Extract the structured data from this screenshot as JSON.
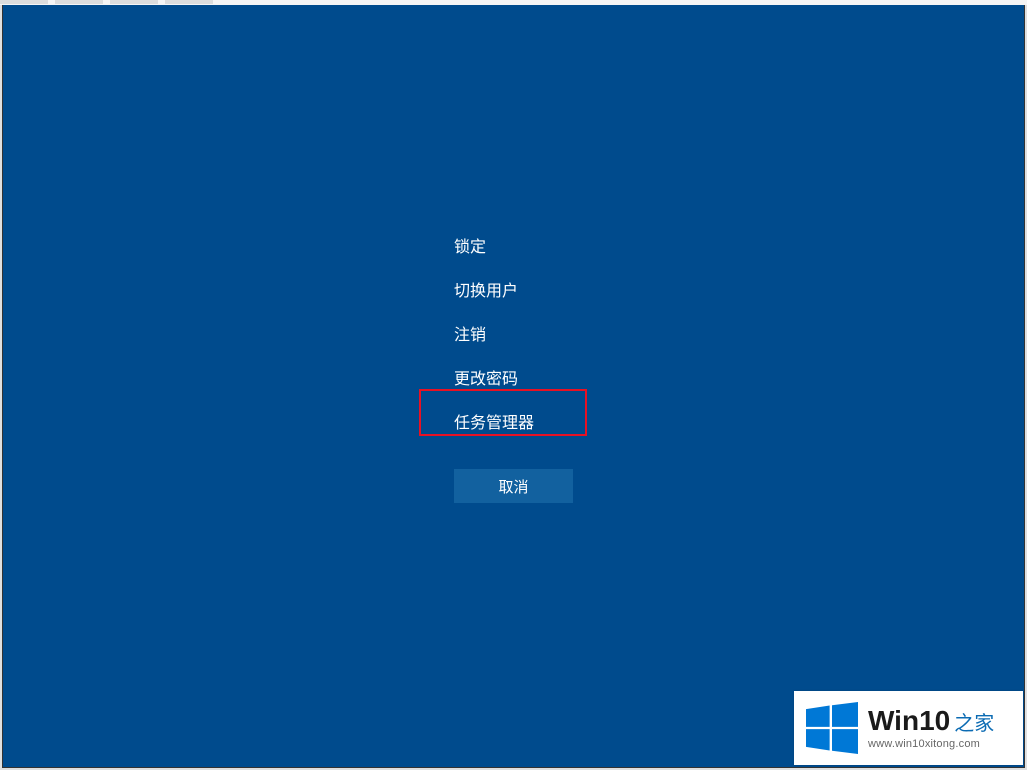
{
  "menu": {
    "lock": "锁定",
    "switch_user": "切换用户",
    "sign_out": "注销",
    "change_password": "更改密码",
    "task_manager": "任务管理器"
  },
  "cancel": "取消",
  "watermark": {
    "brand": "Win10",
    "suffix": "之家",
    "url": "www.win10xitong.com"
  },
  "colors": {
    "background": "#004b8d",
    "highlight_border": "#e81123",
    "cancel_bg": "#12619f"
  }
}
